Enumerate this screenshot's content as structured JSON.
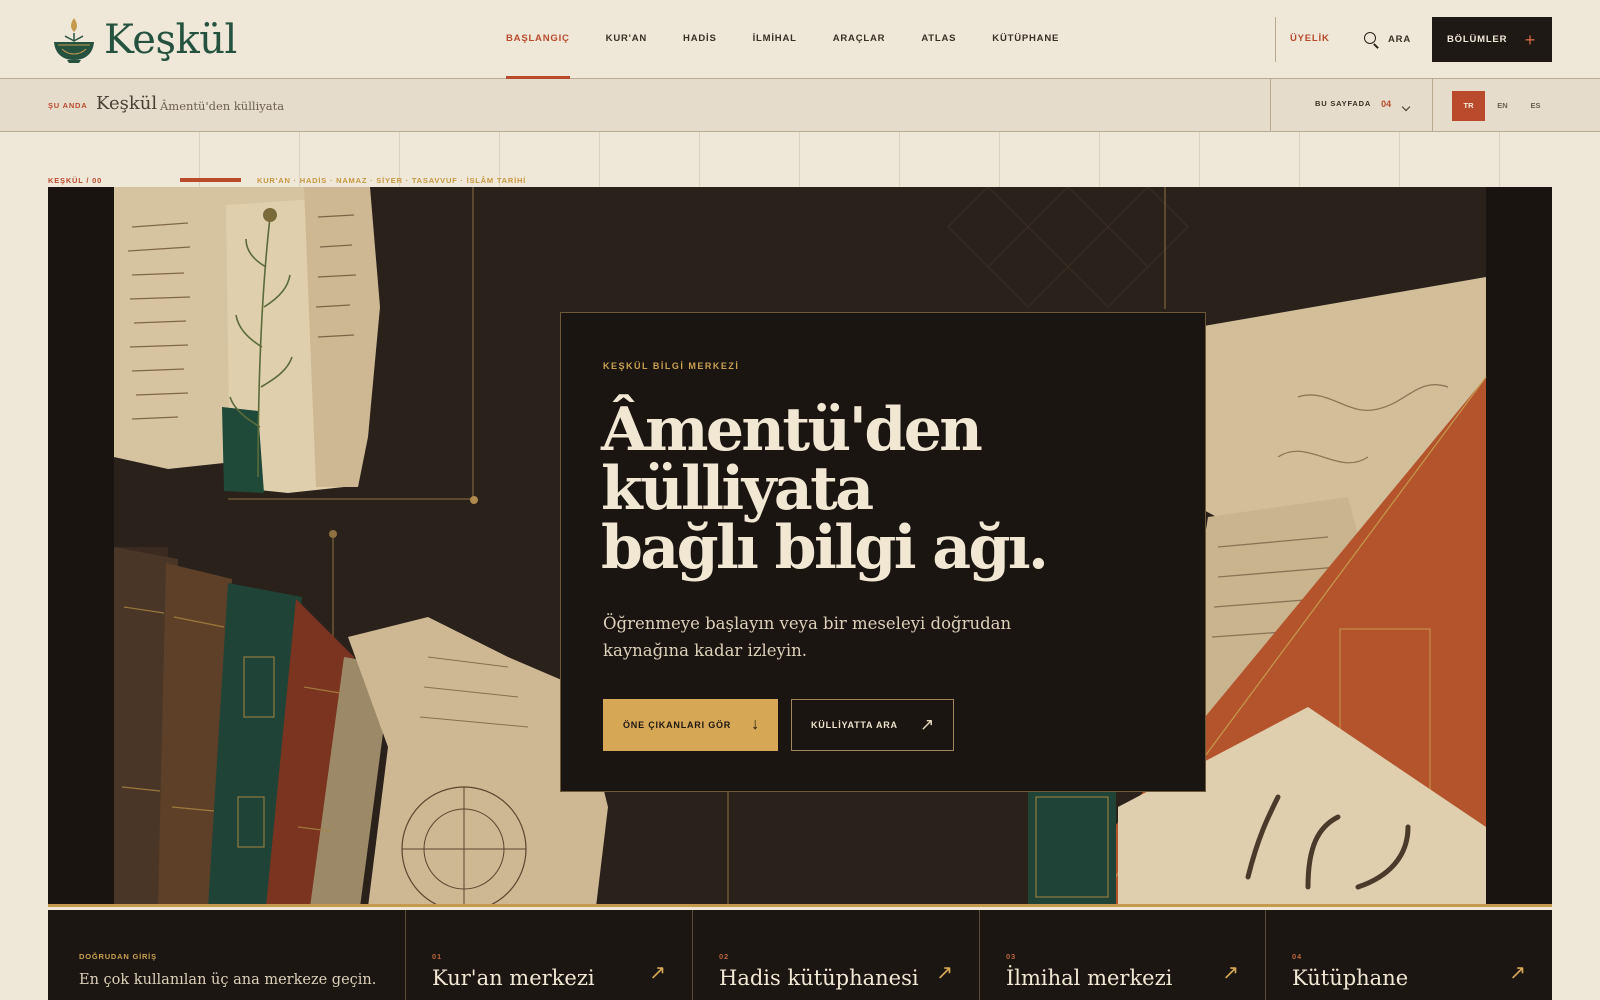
{
  "brand": {
    "name": "Keşkül"
  },
  "nav": {
    "items": [
      {
        "label": "BAŞLANGIÇ",
        "active": true
      },
      {
        "label": "KUR'AN"
      },
      {
        "label": "HADİS"
      },
      {
        "label": "İLMİHAL"
      },
      {
        "label": "ARAÇLAR"
      },
      {
        "label": "ATLAS"
      },
      {
        "label": "KÜTÜPHANE"
      }
    ],
    "member_label": "ÜYELİK",
    "search_label": "ARA",
    "sections_label": "BÖLÜMLER"
  },
  "subbar": {
    "now_label": "ŞU ANDA",
    "title": "Keşkül",
    "subtitle": "Âmentü'den külliyata",
    "on_page_label": "BU SAYFADA",
    "on_page_count": "04",
    "languages": [
      "TR",
      "EN",
      "ES"
    ],
    "active_language": "TR"
  },
  "strip": {
    "label": "KEŞKÜL / 00",
    "topics": "KUR'AN · HADİS · NAMAZ · SİYER · TASAVVUF · İSLÂM TARİHİ"
  },
  "hero": {
    "kicker": "KEŞKÜL BİLGİ MERKEZİ",
    "title_lines": [
      "Âmentü'den",
      "külliyata",
      "bağlı bilgi ağı."
    ],
    "lead": "Öğrenmeye başlayın veya bir meseleyi doğrudan kaynağına kadar izleyin.",
    "primary_cta": "ÖNE ÇIKANLARI GÖR",
    "secondary_cta": "KÜLLİYATTA ARA"
  },
  "direct": {
    "kicker": "DOĞRUDAN GİRİŞ",
    "text": "En çok kullanılan üç ana merkeze geçin.",
    "cards": [
      {
        "num": "01",
        "title": "Kur'an merkezi"
      },
      {
        "num": "02",
        "title": "Hadis kütüphanesi"
      },
      {
        "num": "03",
        "title": "İlmihal merkezi"
      },
      {
        "num": "04",
        "title": "Kütüphane"
      }
    ]
  },
  "colors": {
    "accent": "#b94a2c",
    "gold": "#d6a855",
    "brand_green": "#24523f",
    "dark": "#1c1612",
    "paper": "#efe7d7"
  }
}
